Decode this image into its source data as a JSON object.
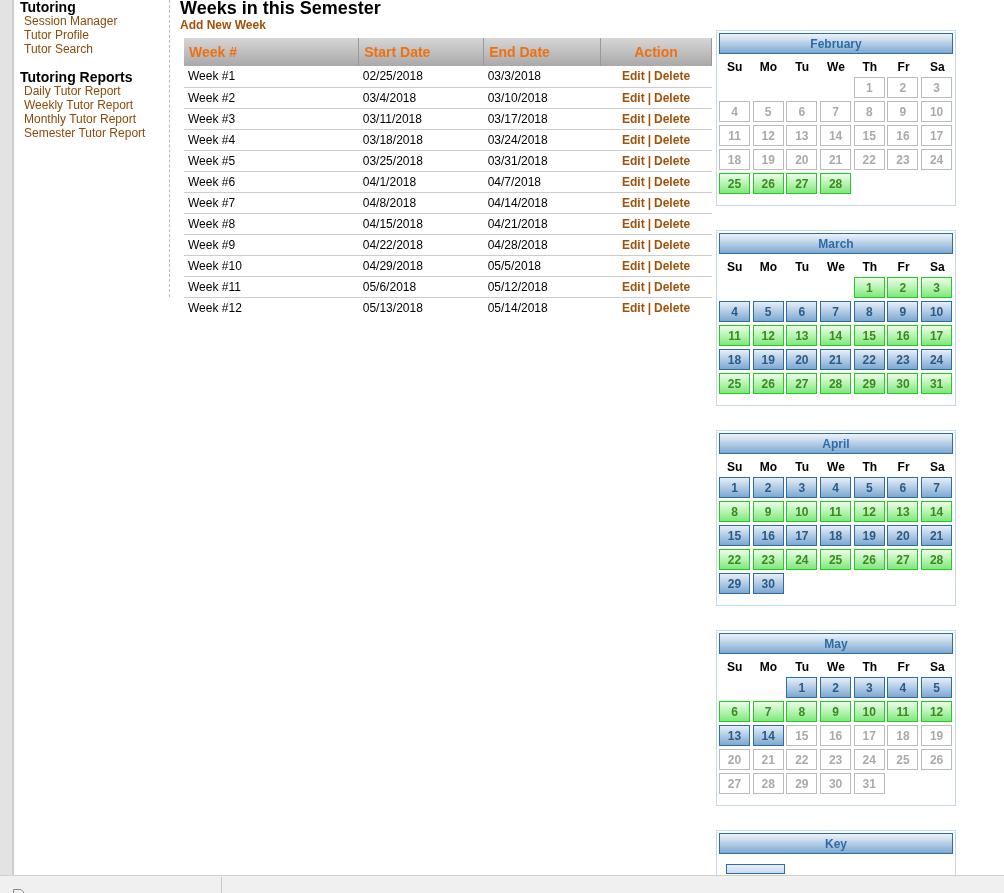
{
  "sidebar": {
    "sections": [
      {
        "title": "Tutoring",
        "items": [
          "Session Manager",
          "Tutor Profile",
          "Tutor Search"
        ]
      },
      {
        "title": "Tutoring Reports",
        "items": [
          "Daily Tutor Report",
          "Weekly Tutor Report",
          "Monthly Tutor Report",
          "Semester Tutor Report"
        ]
      }
    ]
  },
  "page_title": "Weeks in this Semester",
  "add_link": "Add New Week",
  "table": {
    "columns": [
      "Week #",
      "Start Date",
      "End Date",
      "Action"
    ],
    "rows": [
      {
        "week": "Week #1",
        "start": "02/25/2018",
        "end": "03/3/2018",
        "edit": "Edit",
        "sep": "|",
        "delete": "Delete"
      },
      {
        "week": "Week #2",
        "start": "03/4/2018",
        "end": "03/10/2018",
        "edit": "Edit",
        "sep": "|",
        "delete": "Delete"
      },
      {
        "week": "Week #3",
        "start": "03/11/2018",
        "end": "03/17/2018",
        "edit": "Edit",
        "sep": "|",
        "delete": "Delete"
      },
      {
        "week": "Week #4",
        "start": "03/18/2018",
        "end": "03/24/2018",
        "edit": "Edit",
        "sep": "|",
        "delete": "Delete"
      },
      {
        "week": "Week #5",
        "start": "03/25/2018",
        "end": "03/31/2018",
        "edit": "Edit",
        "sep": "|",
        "delete": "Delete"
      },
      {
        "week": "Week #6",
        "start": "04/1/2018",
        "end": "04/7/2018",
        "edit": "Edit",
        "sep": "|",
        "delete": "Delete"
      },
      {
        "week": "Week #7",
        "start": "04/8/2018",
        "end": "04/14/2018",
        "edit": "Edit",
        "sep": "|",
        "delete": "Delete"
      },
      {
        "week": "Week #8",
        "start": "04/15/2018",
        "end": "04/21/2018",
        "edit": "Edit",
        "sep": "|",
        "delete": "Delete"
      },
      {
        "week": "Week #9",
        "start": "04/22/2018",
        "end": "04/28/2018",
        "edit": "Edit",
        "sep": "|",
        "delete": "Delete"
      },
      {
        "week": "Week #10",
        "start": "04/29/2018",
        "end": "05/5/2018",
        "edit": "Edit",
        "sep": "|",
        "delete": "Delete"
      },
      {
        "week": "Week #11",
        "start": "05/6/2018",
        "end": "05/12/2018",
        "edit": "Edit",
        "sep": "|",
        "delete": "Delete"
      },
      {
        "week": "Week #12",
        "start": "05/13/2018",
        "end": "05/14/2018",
        "edit": "Edit",
        "sep": "|",
        "delete": "Delete"
      }
    ]
  },
  "calendars": [
    {
      "month": "February",
      "weekdays": [
        "Su",
        "Mo",
        "Tu",
        "We",
        "Th",
        "Fr",
        "Sa"
      ],
      "weeks": [
        [
          {
            "kind": "empty"
          },
          {
            "kind": "empty"
          },
          {
            "kind": "empty"
          },
          {
            "kind": "empty"
          },
          {
            "day": "1",
            "kind": "off"
          },
          {
            "day": "2",
            "kind": "off"
          },
          {
            "day": "3",
            "kind": "off"
          }
        ],
        [
          {
            "day": "4",
            "kind": "off"
          },
          {
            "day": "5",
            "kind": "off"
          },
          {
            "day": "6",
            "kind": "off"
          },
          {
            "day": "7",
            "kind": "off"
          },
          {
            "day": "8",
            "kind": "off"
          },
          {
            "day": "9",
            "kind": "off"
          },
          {
            "day": "10",
            "kind": "off"
          }
        ],
        [
          {
            "day": "11",
            "kind": "off"
          },
          {
            "day": "12",
            "kind": "off"
          },
          {
            "day": "13",
            "kind": "off"
          },
          {
            "day": "14",
            "kind": "off"
          },
          {
            "day": "15",
            "kind": "off"
          },
          {
            "day": "16",
            "kind": "off"
          },
          {
            "day": "17",
            "kind": "off"
          }
        ],
        [
          {
            "day": "18",
            "kind": "off"
          },
          {
            "day": "19",
            "kind": "off"
          },
          {
            "day": "20",
            "kind": "off"
          },
          {
            "day": "21",
            "kind": "off"
          },
          {
            "day": "22",
            "kind": "off"
          },
          {
            "day": "23",
            "kind": "off"
          },
          {
            "day": "24",
            "kind": "off"
          }
        ],
        [
          {
            "day": "25",
            "kind": "green"
          },
          {
            "day": "26",
            "kind": "green"
          },
          {
            "day": "27",
            "kind": "green"
          },
          {
            "day": "28",
            "kind": "green"
          }
        ]
      ]
    },
    {
      "month": "March",
      "weekdays": [
        "Su",
        "Mo",
        "Tu",
        "We",
        "Th",
        "Fr",
        "Sa"
      ],
      "weeks": [
        [
          {
            "kind": "empty"
          },
          {
            "kind": "empty"
          },
          {
            "kind": "empty"
          },
          {
            "kind": "empty"
          },
          {
            "day": "1",
            "kind": "green"
          },
          {
            "day": "2",
            "kind": "green"
          },
          {
            "day": "3",
            "kind": "green"
          }
        ],
        [
          {
            "day": "4",
            "kind": "blue"
          },
          {
            "day": "5",
            "kind": "blue"
          },
          {
            "day": "6",
            "kind": "blue"
          },
          {
            "day": "7",
            "kind": "blue"
          },
          {
            "day": "8",
            "kind": "blue"
          },
          {
            "day": "9",
            "kind": "blue"
          },
          {
            "day": "10",
            "kind": "blue"
          }
        ],
        [
          {
            "day": "11",
            "kind": "green"
          },
          {
            "day": "12",
            "kind": "green"
          },
          {
            "day": "13",
            "kind": "green"
          },
          {
            "day": "14",
            "kind": "green"
          },
          {
            "day": "15",
            "kind": "green"
          },
          {
            "day": "16",
            "kind": "green"
          },
          {
            "day": "17",
            "kind": "green"
          }
        ],
        [
          {
            "day": "18",
            "kind": "blue"
          },
          {
            "day": "19",
            "kind": "blue"
          },
          {
            "day": "20",
            "kind": "blue"
          },
          {
            "day": "21",
            "kind": "blue"
          },
          {
            "day": "22",
            "kind": "blue"
          },
          {
            "day": "23",
            "kind": "blue"
          },
          {
            "day": "24",
            "kind": "blue"
          }
        ],
        [
          {
            "day": "25",
            "kind": "green"
          },
          {
            "day": "26",
            "kind": "green"
          },
          {
            "day": "27",
            "kind": "green"
          },
          {
            "day": "28",
            "kind": "green"
          },
          {
            "day": "29",
            "kind": "green"
          },
          {
            "day": "30",
            "kind": "green"
          },
          {
            "day": "31",
            "kind": "green"
          }
        ]
      ]
    },
    {
      "month": "April",
      "weekdays": [
        "Su",
        "Mo",
        "Tu",
        "We",
        "Th",
        "Fr",
        "Sa"
      ],
      "weeks": [
        [
          {
            "day": "1",
            "kind": "blue"
          },
          {
            "day": "2",
            "kind": "blue"
          },
          {
            "day": "3",
            "kind": "blue"
          },
          {
            "day": "4",
            "kind": "blue"
          },
          {
            "day": "5",
            "kind": "blue"
          },
          {
            "day": "6",
            "kind": "blue"
          },
          {
            "day": "7",
            "kind": "blue"
          }
        ],
        [
          {
            "day": "8",
            "kind": "green"
          },
          {
            "day": "9",
            "kind": "green"
          },
          {
            "day": "10",
            "kind": "green"
          },
          {
            "day": "11",
            "kind": "green"
          },
          {
            "day": "12",
            "kind": "green"
          },
          {
            "day": "13",
            "kind": "green"
          },
          {
            "day": "14",
            "kind": "green"
          }
        ],
        [
          {
            "day": "15",
            "kind": "blue"
          },
          {
            "day": "16",
            "kind": "blue"
          },
          {
            "day": "17",
            "kind": "blue"
          },
          {
            "day": "18",
            "kind": "blue"
          },
          {
            "day": "19",
            "kind": "blue"
          },
          {
            "day": "20",
            "kind": "blue"
          },
          {
            "day": "21",
            "kind": "blue"
          }
        ],
        [
          {
            "day": "22",
            "kind": "green"
          },
          {
            "day": "23",
            "kind": "green"
          },
          {
            "day": "24",
            "kind": "green"
          },
          {
            "day": "25",
            "kind": "green"
          },
          {
            "day": "26",
            "kind": "green"
          },
          {
            "day": "27",
            "kind": "green"
          },
          {
            "day": "28",
            "kind": "green"
          }
        ],
        [
          {
            "day": "29",
            "kind": "blue"
          },
          {
            "day": "30",
            "kind": "blue"
          }
        ]
      ]
    },
    {
      "month": "May",
      "weekdays": [
        "Su",
        "Mo",
        "Tu",
        "We",
        "Th",
        "Fr",
        "Sa"
      ],
      "weeks": [
        [
          {
            "kind": "empty"
          },
          {
            "kind": "empty"
          },
          {
            "day": "1",
            "kind": "blue"
          },
          {
            "day": "2",
            "kind": "blue"
          },
          {
            "day": "3",
            "kind": "blue"
          },
          {
            "day": "4",
            "kind": "blue"
          },
          {
            "day": "5",
            "kind": "blue"
          }
        ],
        [
          {
            "day": "6",
            "kind": "green"
          },
          {
            "day": "7",
            "kind": "green"
          },
          {
            "day": "8",
            "kind": "green"
          },
          {
            "day": "9",
            "kind": "green"
          },
          {
            "day": "10",
            "kind": "green"
          },
          {
            "day": "11",
            "kind": "green"
          },
          {
            "day": "12",
            "kind": "green"
          }
        ],
        [
          {
            "day": "13",
            "kind": "blue"
          },
          {
            "day": "14",
            "kind": "blue"
          },
          {
            "day": "15",
            "kind": "off"
          },
          {
            "day": "16",
            "kind": "off"
          },
          {
            "day": "17",
            "kind": "off"
          },
          {
            "day": "18",
            "kind": "off"
          },
          {
            "day": "19",
            "kind": "off"
          }
        ],
        [
          {
            "day": "20",
            "kind": "off"
          },
          {
            "day": "21",
            "kind": "off"
          },
          {
            "day": "22",
            "kind": "off"
          },
          {
            "day": "23",
            "kind": "off"
          },
          {
            "day": "24",
            "kind": "off"
          },
          {
            "day": "25",
            "kind": "off"
          },
          {
            "day": "26",
            "kind": "off"
          }
        ],
        [
          {
            "day": "27",
            "kind": "off"
          },
          {
            "day": "28",
            "kind": "off"
          },
          {
            "day": "29",
            "kind": "off"
          },
          {
            "day": "30",
            "kind": "off"
          },
          {
            "day": "31",
            "kind": "off"
          }
        ]
      ]
    }
  ],
  "key": {
    "title": "Key"
  }
}
